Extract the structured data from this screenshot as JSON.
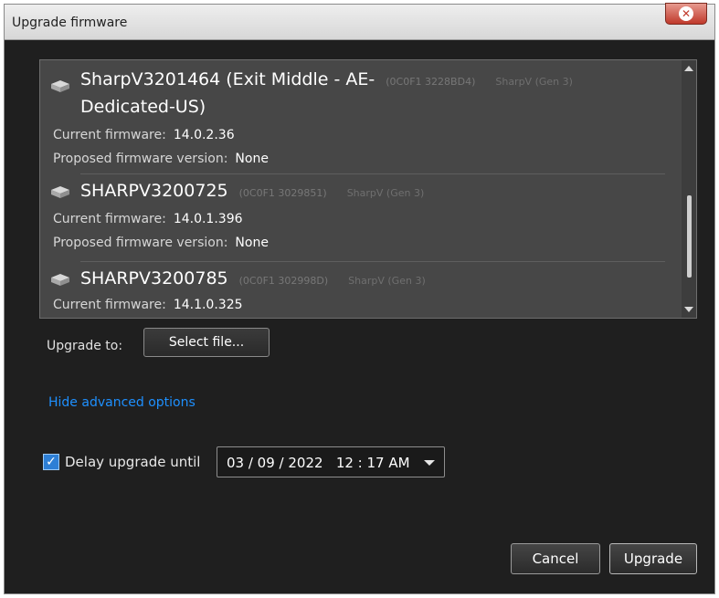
{
  "window": {
    "title": "Upgrade firmware",
    "close_glyph": "✕"
  },
  "devices": [
    {
      "name": "SharpV3201464 (Exit Middle - AE-",
      "name_line2": "Dedicated-US)",
      "current_label": "Current firmware:",
      "current_value": "14.0.2.36",
      "proposed_label": "Proposed firmware version:",
      "proposed_value": "None",
      "icon": "camera-icon"
    },
    {
      "name": "SHARPV3200725",
      "current_label": "Current firmware:",
      "current_value": "14.0.1.396",
      "proposed_label": "Proposed firmware version:",
      "proposed_value": "None",
      "icon": "camera-icon"
    },
    {
      "name": "SHARPV3200785",
      "current_label": "Current firmware:",
      "current_value": "14.1.0.325",
      "icon": "camera-icon"
    }
  ],
  "upgrade_to": {
    "label": "Upgrade to:",
    "button": "Select file..."
  },
  "advanced_link": "Hide advanced options",
  "delay": {
    "checked": true,
    "label": "Delay upgrade until",
    "datetime": "03 / 09 / 2022   12 : 17 AM"
  },
  "buttons": {
    "cancel": "Cancel",
    "upgrade": "Upgrade"
  },
  "colors": {
    "window_bg": "#1f1f1f",
    "list_bg": "#474747",
    "link": "#1e90ff",
    "checkbox": "#2d7fd6"
  }
}
